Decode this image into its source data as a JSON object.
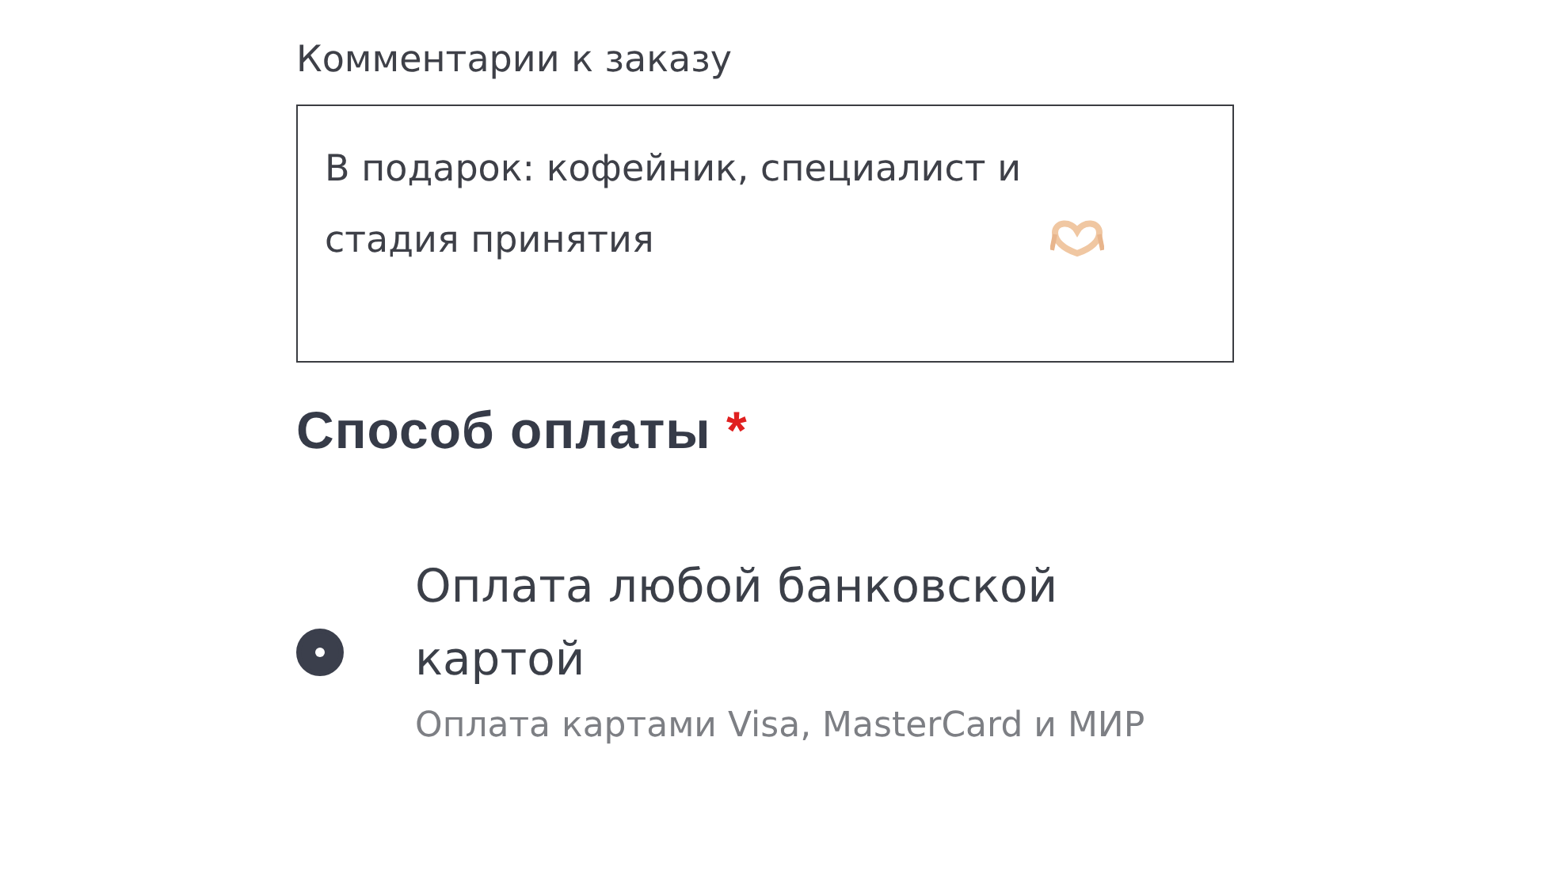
{
  "comment": {
    "label": "Комментарии к заказу",
    "value": "В подарок: кофейник, специалист и стадия принятия"
  },
  "payment": {
    "title": "Способ оплаты",
    "required_mark": "*",
    "options": [
      {
        "title": "Оплата любой банковской картой",
        "description": "Оплата картами Visa, MasterCard и МИР",
        "selected": true
      }
    ]
  }
}
